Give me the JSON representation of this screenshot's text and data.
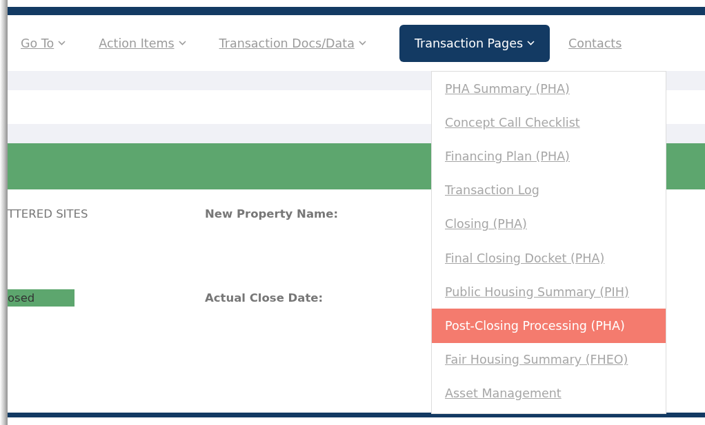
{
  "nav": [
    {
      "label": "Go To",
      "caret": true,
      "selected": false
    },
    {
      "label": "Action Items",
      "caret": true,
      "selected": false
    },
    {
      "label": "Transaction Docs/Data",
      "caret": true,
      "selected": false
    },
    {
      "label": "Transaction Pages",
      "caret": true,
      "selected": true
    },
    {
      "label": "Contacts",
      "caret": false,
      "selected": false
    }
  ],
  "dropdown": [
    {
      "label": "PHA Summary (PHA)",
      "selected": false
    },
    {
      "label": "Concept Call Checklist",
      "selected": false
    },
    {
      "label": "Financing Plan (PHA)",
      "selected": false
    },
    {
      "label": "Transaction Log",
      "selected": false
    },
    {
      "label": "Closing (PHA)",
      "selected": false
    },
    {
      "label": "Final Closing Docket (PHA)",
      "selected": false
    },
    {
      "label": "Public Housing Summary (PIH)",
      "selected": false
    },
    {
      "label": "Post-Closing Processing (PHA)",
      "selected": true
    },
    {
      "label": "Fair Housing Summary (FHEO)",
      "selected": false
    },
    {
      "label": "Asset Management",
      "selected": false
    }
  ],
  "fields": [
    {
      "value": "TTERED SITES",
      "kind": "text",
      "label": "New Property Name:"
    },
    {
      "value": "osed",
      "kind": "status",
      "label": "Actual Close Date:"
    }
  ]
}
